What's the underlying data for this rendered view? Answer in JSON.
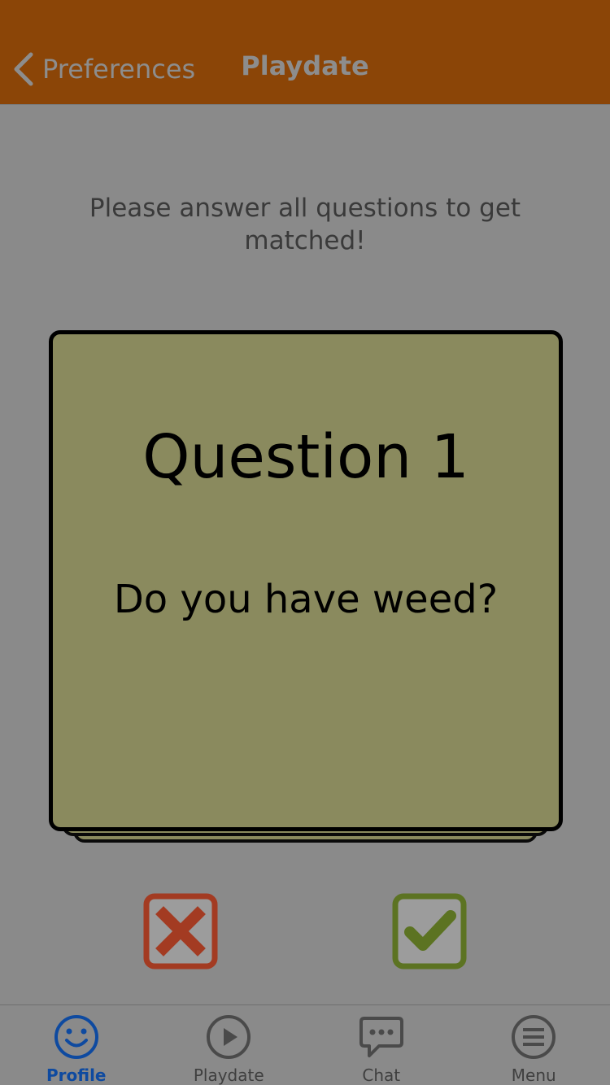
{
  "nav": {
    "back_label": "Preferences",
    "title": "Playdate"
  },
  "instructions": "Please answer all questions to get matched!",
  "card": {
    "title": "Question 1",
    "question": "Do you have weed?"
  },
  "answers": {
    "no_icon": "x-box-icon",
    "yes_icon": "check-box-icon"
  },
  "tabs": [
    {
      "label": "Profile",
      "icon": "smiley-icon",
      "active": true
    },
    {
      "label": "Playdate",
      "icon": "play-circle-icon",
      "active": false
    },
    {
      "label": "Chat",
      "icon": "chat-bubble-icon",
      "active": false
    },
    {
      "label": "Menu",
      "icon": "menu-circle-icon",
      "active": false
    }
  ],
  "colors": {
    "navbar": "#8b4507",
    "overlay_background": "#8a8a8a",
    "card": "#8a8a5e",
    "no_button": "#a33b22",
    "yes_button": "#5c7322",
    "active_tab": "#0e4aa0",
    "inactive_tab": "#3f3f3f"
  }
}
